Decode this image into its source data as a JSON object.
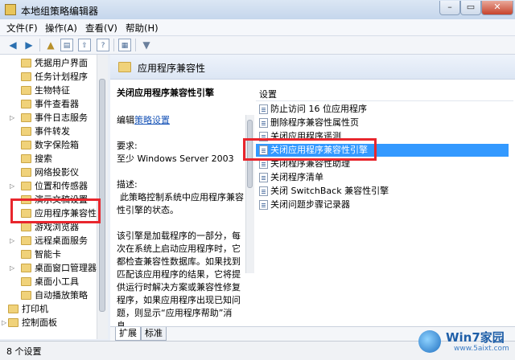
{
  "window": {
    "title": "本地组策略编辑器",
    "min_glyph": "–",
    "max_glyph": "▭",
    "close_glyph": "✕"
  },
  "menu": [
    "文件(F)",
    "操作(A)",
    "查看(V)",
    "帮助(H)"
  ],
  "toolbar_icons": [
    "back-arrow-icon",
    "forward-arrow-icon",
    "up-folder-icon",
    "show-hide-tree-icon",
    "export-list-icon",
    "help-icon",
    "view-icon",
    "filter-icon"
  ],
  "tree": {
    "items": [
      {
        "label": "凭据用户界面",
        "expand": ""
      },
      {
        "label": "任务计划程序",
        "expand": ""
      },
      {
        "label": "生物特征",
        "expand": ""
      },
      {
        "label": "事件查看器",
        "expand": ""
      },
      {
        "label": "事件日志服务",
        "expand": "▷"
      },
      {
        "label": "事件转发",
        "expand": ""
      },
      {
        "label": "数字保险箱",
        "expand": ""
      },
      {
        "label": "搜索",
        "expand": ""
      },
      {
        "label": "网络投影仪",
        "expand": ""
      },
      {
        "label": "位置和传感器",
        "expand": "▷"
      },
      {
        "label": "演示文稿设置",
        "expand": ""
      },
      {
        "label": "应用程序兼容性",
        "expand": ""
      },
      {
        "label": "游戏浏览器",
        "expand": ""
      },
      {
        "label": "远程桌面服务",
        "expand": "▷"
      },
      {
        "label": "智能卡",
        "expand": ""
      },
      {
        "label": "桌面窗口管理器",
        "expand": "▷"
      },
      {
        "label": "桌面小工具",
        "expand": ""
      },
      {
        "label": "自动播放策略",
        "expand": ""
      }
    ],
    "root_items": [
      {
        "label": "打印机",
        "expand": ""
      },
      {
        "label": "控制面板",
        "expand": "▷"
      }
    ]
  },
  "right_header": {
    "title": "应用程序兼容性"
  },
  "description": {
    "title": "关闭应用程序兼容性引擎",
    "edit_prefix": "编辑",
    "edit_link": "策略设置",
    "req_label": "要求:",
    "req_value": "至少 Windows Server 2003",
    "desc_label": "描述:",
    "desc_text": "此策略控制系统中应用程序兼容性引擎的状态。",
    "body_text": "该引擎是加载程序的一部分，每次在系统上启动应用程序时，它都检查兼容性数据库。如果找到匹配该应用程序的结果，它将提供运行时解决方案或兼容性修复程序，如果应用程序出现已知问题，则显示“应用程序帮助”消息。"
  },
  "list": {
    "header": "设置",
    "rows": [
      {
        "label": "防止访问 16 位应用程序",
        "selected": false
      },
      {
        "label": "删除程序兼容性属性页",
        "selected": false
      },
      {
        "label": "关闭应用程序遥测",
        "selected": false
      },
      {
        "label": "关闭应用程序兼容性引擎",
        "selected": true
      },
      {
        "label": "关闭程序兼容性助理",
        "selected": false
      },
      {
        "label": "关闭程序清单",
        "selected": false
      },
      {
        "label": "关闭 SwitchBack 兼容性引擎",
        "selected": false
      },
      {
        "label": "关闭问题步骤记录器",
        "selected": false
      }
    ]
  },
  "tabs": [
    "扩展",
    "标准"
  ],
  "status": "8 个设置",
  "watermark": {
    "brand": "Win7家园",
    "url": "www.5aixt.com"
  },
  "colors": {
    "selection": "#3399ff",
    "highlight_box": "#e8262d",
    "link": "#1a56b8"
  }
}
